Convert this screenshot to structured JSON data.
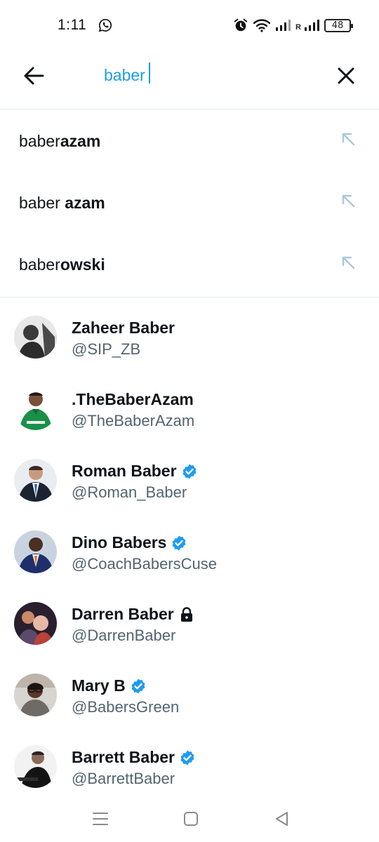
{
  "status_bar": {
    "time": "1:11",
    "battery": "48",
    "carrier_label": "R"
  },
  "search": {
    "query": "baber"
  },
  "suggestions": [
    {
      "prefix": "baber",
      "rest": "azam"
    },
    {
      "prefix": "baber ",
      "rest": "azam"
    },
    {
      "prefix": "baber",
      "rest": "owski"
    }
  ],
  "users": [
    {
      "name": "Zaheer Baber",
      "handle": "@SIP_ZB",
      "badge": "none"
    },
    {
      "name": ".TheBaberAzam",
      "handle": "@TheBaberAzam",
      "badge": "none"
    },
    {
      "name": "Roman Baber",
      "handle": "@Roman_Baber",
      "badge": "verified"
    },
    {
      "name": "Dino Babers",
      "handle": "@CoachBabersCuse",
      "badge": "verified"
    },
    {
      "name": "Darren Baber",
      "handle": "@DarrenBaber",
      "badge": "protected"
    },
    {
      "name": "Mary B",
      "handle": "@BabersGreen",
      "badge": "verified"
    },
    {
      "name": "Barrett Baber",
      "handle": "@BarrettBaber",
      "badge": "verified"
    }
  ],
  "colors": {
    "accent": "#1d9bf0",
    "text_primary": "#0f1419",
    "text_secondary": "#536471",
    "divider": "#e6e8ea"
  },
  "icons": {
    "back": "arrow-left-icon",
    "clear": "close-icon",
    "suggestion_fill": "arrow-up-left-icon",
    "verified": "verified-badge-icon",
    "protected": "lock-icon"
  }
}
